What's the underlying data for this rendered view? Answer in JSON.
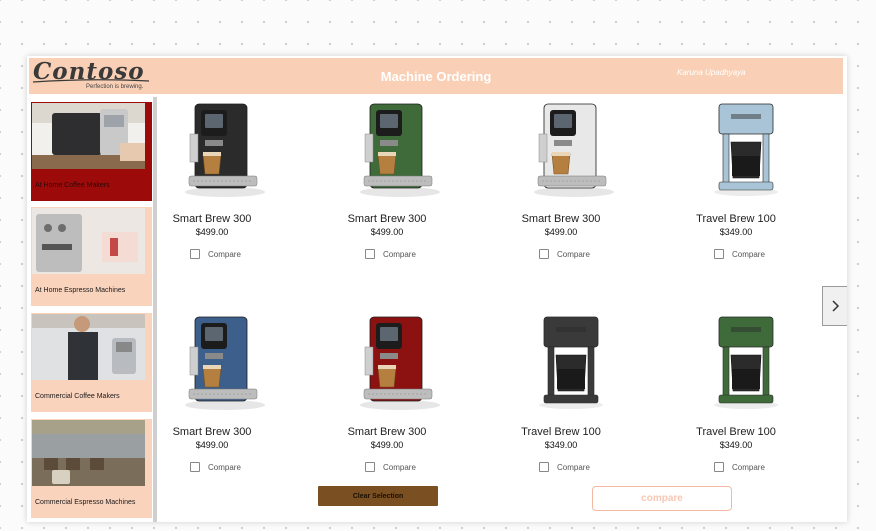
{
  "header": {
    "logo_text": "Contoso",
    "tagline": "Perfection is brewing.",
    "title": "Machine Ordering",
    "user": "Karuna Upadhyaya"
  },
  "colors": {
    "header_bg": "#f9d0b6",
    "category_bg": "#fad3bd",
    "category_selected_bg": "#9d0a0a",
    "clear_button_bg": "#7a5023",
    "compare_button_border": "#f3b9a3"
  },
  "sidebar": {
    "categories": [
      {
        "label": "At Home Coffee Makers",
        "selected": true
      },
      {
        "label": "At Home Espresso Machines",
        "selected": false
      },
      {
        "label": "Commercial Coffee Makers",
        "selected": false
      },
      {
        "label": "Commercial Espresso Machines",
        "selected": false
      }
    ]
  },
  "products": [
    {
      "name": "Smart Brew 300",
      "price": "$499.00",
      "compare_label": "Compare",
      "color": "#2b2b2b",
      "kind": "espresso"
    },
    {
      "name": "Smart Brew 300",
      "price": "$499.00",
      "compare_label": "Compare",
      "color": "#3f6b3b",
      "kind": "espresso"
    },
    {
      "name": "Smart Brew 300",
      "price": "$499.00",
      "compare_label": "Compare",
      "color": "#e8e8e8",
      "kind": "espresso"
    },
    {
      "name": "Travel Brew 100",
      "price": "$349.00",
      "compare_label": "Compare",
      "color": "#a9c4d6",
      "kind": "drip"
    },
    {
      "name": "Smart Brew 300",
      "price": "$499.00",
      "compare_label": "Compare",
      "color": "#3d5f8c",
      "kind": "espresso"
    },
    {
      "name": "Smart Brew 300",
      "price": "$499.00",
      "compare_label": "Compare",
      "color": "#8c1212",
      "kind": "espresso"
    },
    {
      "name": "Travel Brew 100",
      "price": "$349.00",
      "compare_label": "Compare",
      "color": "#3a3a3a",
      "kind": "drip"
    },
    {
      "name": "Travel Brew 100",
      "price": "$349.00",
      "compare_label": "Compare",
      "color": "#3f6b3b",
      "kind": "drip"
    }
  ],
  "actions": {
    "clear_label": "Clear Selection",
    "compare_label": "compare",
    "next_icon": "chevron-right-icon"
  }
}
